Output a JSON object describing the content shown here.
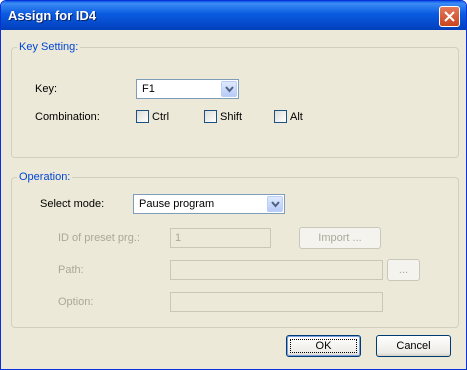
{
  "window": {
    "title": "Assign for ID4"
  },
  "key_setting": {
    "legend": "Key Setting:",
    "key_label": "Key:",
    "key_value": "F1",
    "combination_label": "Combination:",
    "ctrl_label": "Ctrl",
    "shift_label": "Shift",
    "alt_label": "Alt"
  },
  "operation": {
    "legend": "Operation:",
    "select_mode_label": "Select mode:",
    "select_mode_value": "Pause program",
    "id_label": "ID of preset prg.:",
    "id_value": "1",
    "import_label": "Import ...",
    "path_label": "Path:",
    "path_value": "",
    "browse_label": "...",
    "option_label": "Option:",
    "option_value": ""
  },
  "buttons": {
    "ok": "OK",
    "cancel": "Cancel"
  },
  "icons": {
    "close": "close-icon",
    "dropdown": "chevron-down-icon"
  }
}
